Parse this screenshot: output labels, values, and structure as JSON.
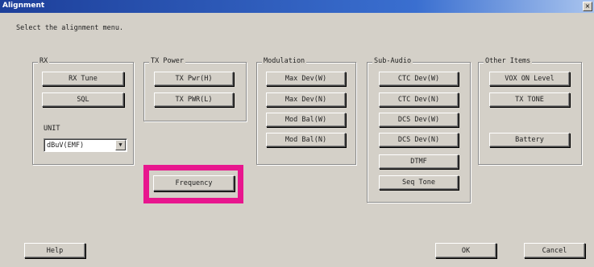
{
  "window": {
    "title": "Alignment",
    "close_label": "×"
  },
  "prompt": "Select the alignment menu.",
  "groups": {
    "rx": {
      "label": "RX",
      "buttons": [
        "RX Tune",
        "SQL"
      ],
      "unit_label": "UNIT",
      "unit_select": {
        "value": "dBuV(EMF)"
      }
    },
    "tx_power": {
      "label": "TX Power",
      "buttons": [
        "TX Pwr(H)",
        "TX PWR(L)"
      ]
    },
    "modulation": {
      "label": "Modulation",
      "buttons": [
        "Max Dev(W)",
        "Max Dev(N)",
        "Mod Bal(W)",
        "Mod Bal(N)"
      ]
    },
    "sub_audio": {
      "label": "Sub-Audio",
      "buttons": [
        "CTC Dev(W)",
        "CTC Dev(N)",
        "DCS Dev(W)",
        "DCS Dev(N)",
        "DTMF",
        "Seq Tone"
      ]
    },
    "other_items": {
      "label": "Other Items",
      "buttons": [
        "VOX ON Level",
        "TX TONE",
        "Battery"
      ]
    }
  },
  "frequency_button": "Frequency",
  "highlight_color": "#e8168e",
  "footer": {
    "help": "Help",
    "ok": "OK",
    "cancel": "Cancel"
  }
}
